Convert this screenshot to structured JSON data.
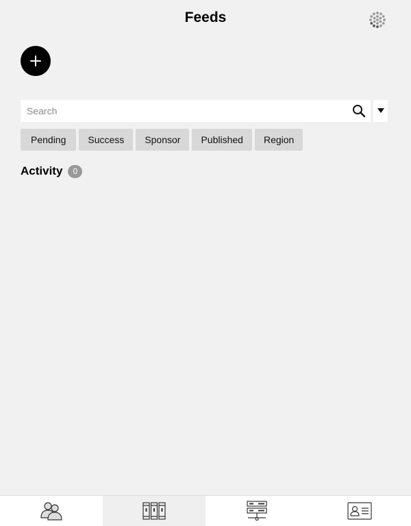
{
  "header": {
    "title": "Feeds",
    "status_icon": "loading-spinner-icon"
  },
  "actions": {
    "add_icon": "plus-icon"
  },
  "search": {
    "placeholder": "Search",
    "value": "",
    "search_icon": "magnifier-icon",
    "dropdown_icon": "caret-down-icon"
  },
  "filters": [
    {
      "label": "Pending"
    },
    {
      "label": "Success"
    },
    {
      "label": "Sponsor"
    },
    {
      "label": "Published"
    },
    {
      "label": "Region"
    }
  ],
  "activity": {
    "title": "Activity",
    "count": "0"
  },
  "bottom_nav": {
    "active_index": 1,
    "items": [
      {
        "icon": "people-icon"
      },
      {
        "icon": "binders-icon"
      },
      {
        "icon": "network-servers-icon"
      },
      {
        "icon": "contact-card-icon"
      }
    ]
  },
  "colors": {
    "background": "#f1f1f1",
    "chip": "#d8d8d8",
    "badge": "#999999",
    "accent": "#000000"
  }
}
